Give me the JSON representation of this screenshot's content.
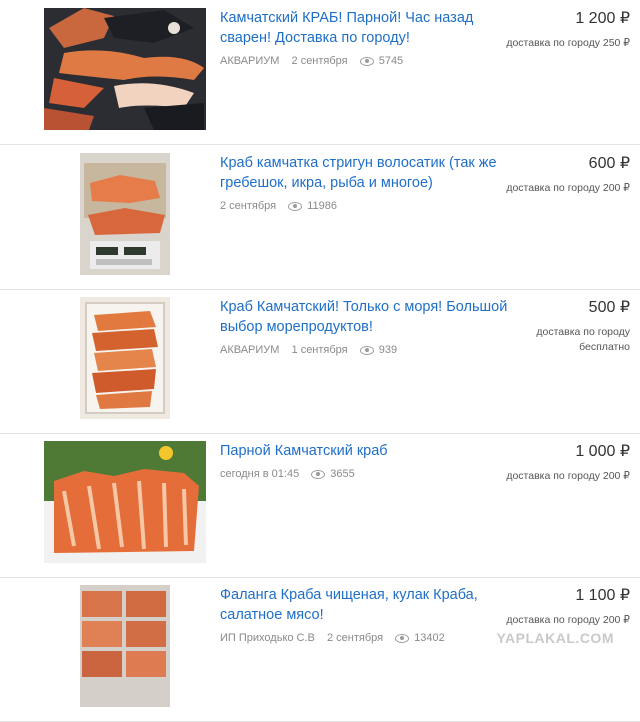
{
  "listings": [
    {
      "title": "Камчатский КРАБ! Парной! Час назад сварен! Доставка по городу!",
      "seller": "АКВАРИУМ",
      "date": "2 сентября",
      "views": "5745",
      "price": "1 200 ₽",
      "delivery": "доставка по городу 250 ₽",
      "image_icon": "crab-legs-gloved-hand-photo"
    },
    {
      "title": "Краб камчатка стригун волосатик (так же гребешок, икра, рыба и многое)",
      "seller": "",
      "date": "2 сентября",
      "views": "11986",
      "price": "600 ₽",
      "delivery": "доставка по городу 200 ₽",
      "image_icon": "crab-on-scale-photo"
    },
    {
      "title": "Краб Камчатский! Только с моря! Большой выбор морепродуктов!",
      "seller": "АКВАРИУМ",
      "date": "1 сентября",
      "views": "939",
      "price": "500 ₽",
      "delivery": "доставка по городу бесплатно",
      "image_icon": "crab-legs-in-box-photo"
    },
    {
      "title": "Парной Камчатский краб",
      "seller": "",
      "date": "сегодня в 01:45",
      "views": "3655",
      "price": "1 000 ₽",
      "delivery": "доставка по городу 200 ₽",
      "image_icon": "crab-legs-on-grass-photo"
    },
    {
      "title": "Фаланга Краба чищеная, кулак Краба, салатное мясо!",
      "seller": "ИП Приходько С.В",
      "date": "2 сентября",
      "views": "13402",
      "price": "1 100 ₽",
      "delivery": "доставка по городу 200 ₽",
      "image_icon": "crab-meat-packs-photo"
    }
  ],
  "watermark": "YAPLAKAL.COM"
}
